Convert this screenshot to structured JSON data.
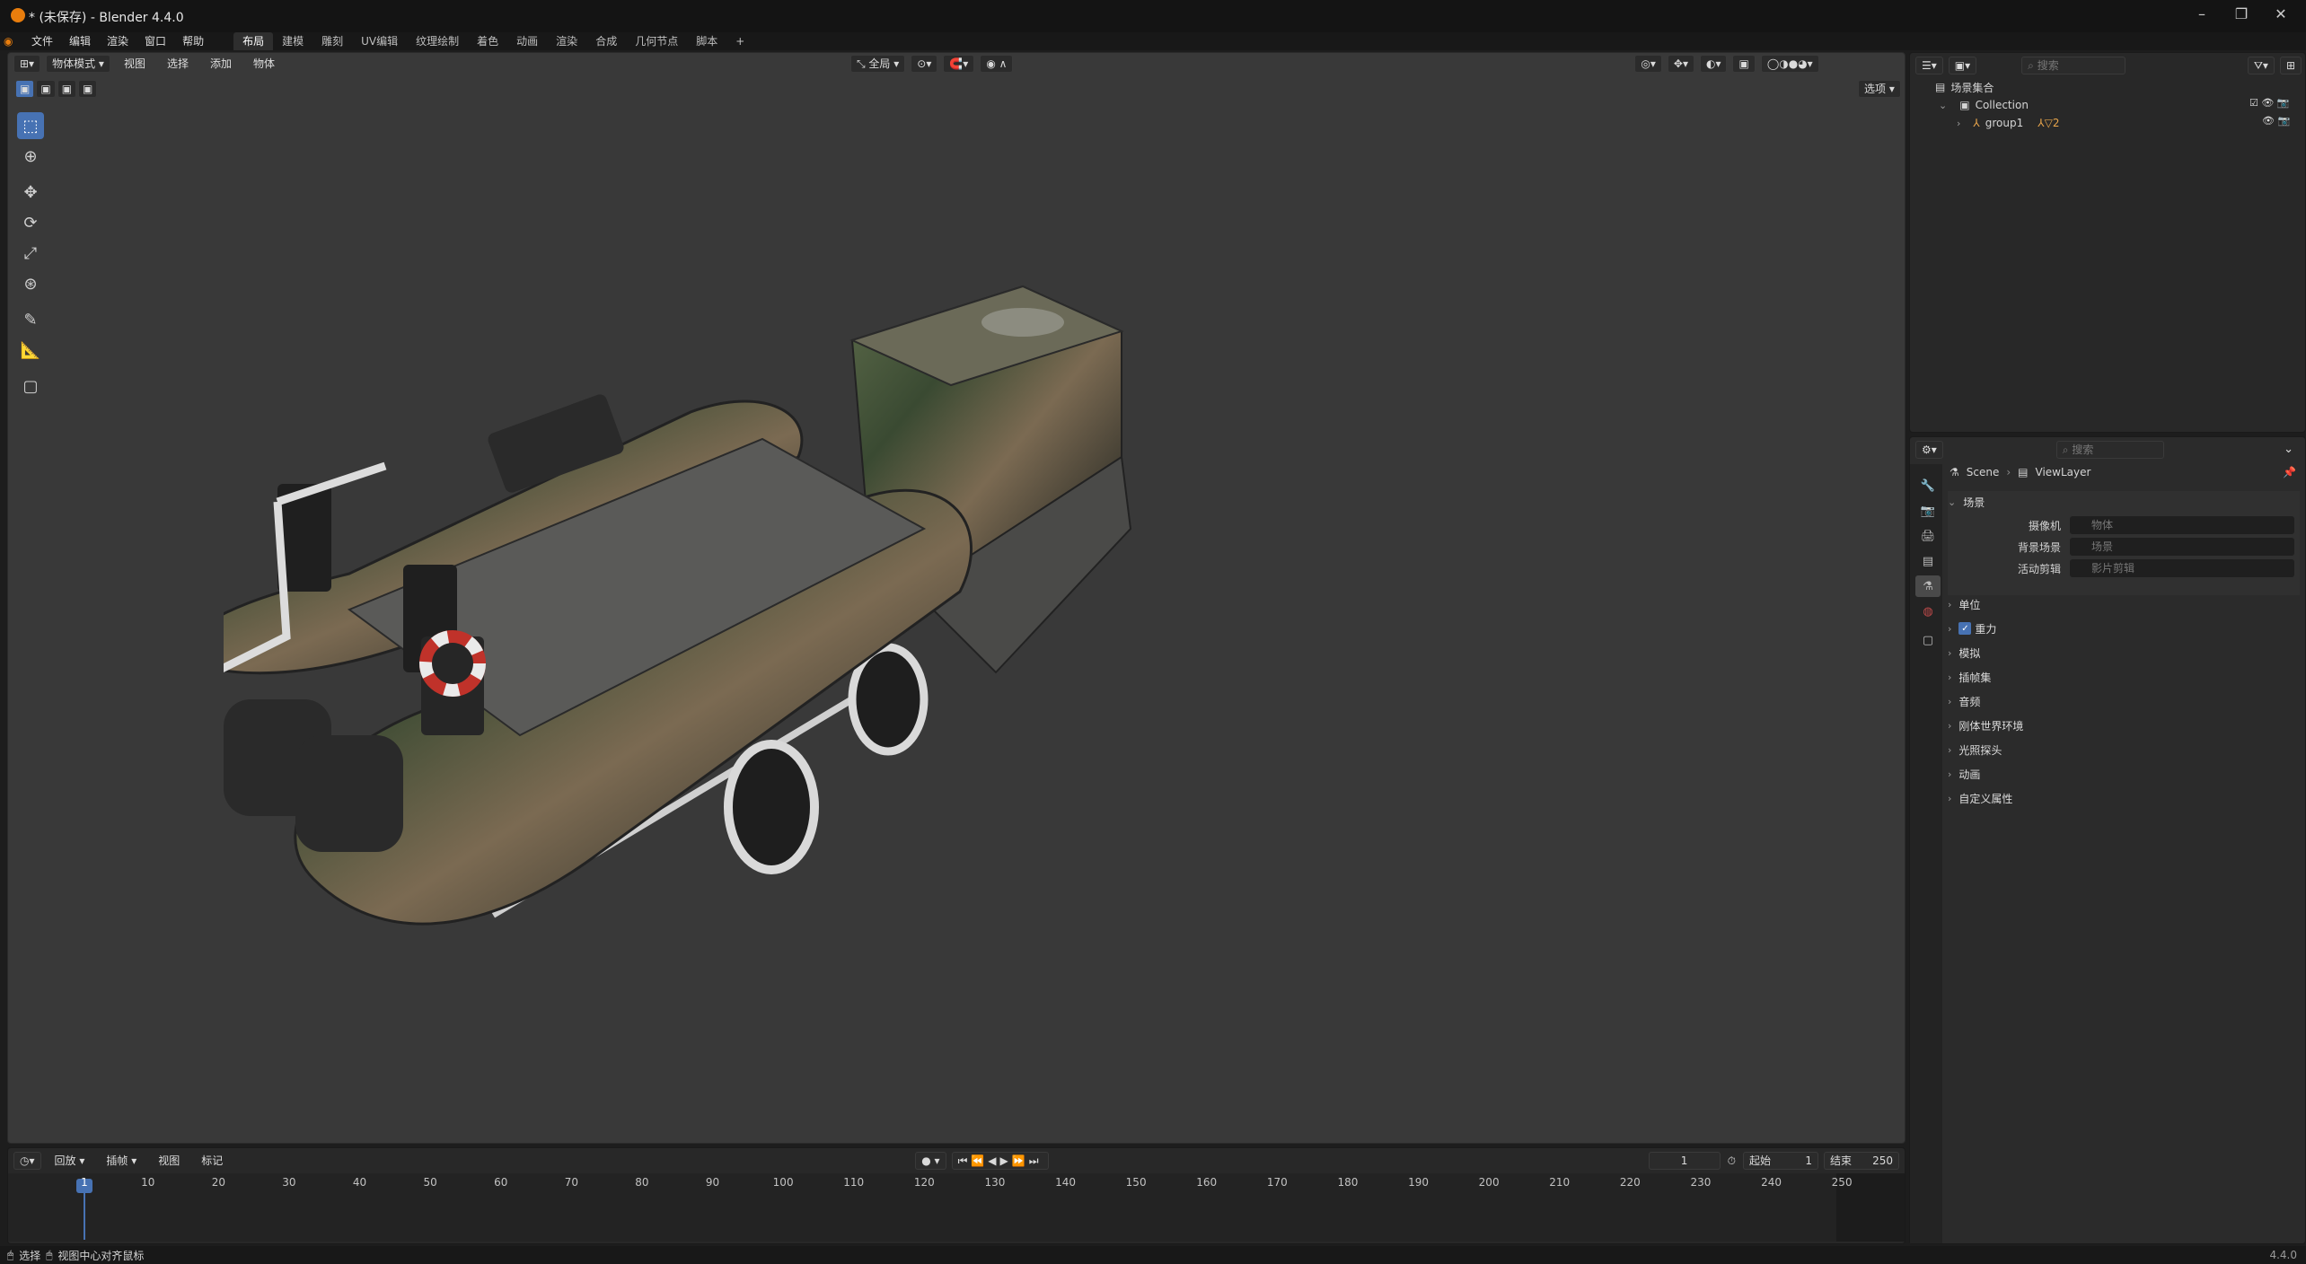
{
  "window": {
    "title": "* (未保存) - Blender 4.4.0",
    "min": "–",
    "max": "❐",
    "close": "✕"
  },
  "menu": [
    "文件",
    "编辑",
    "渲染",
    "窗口",
    "帮助"
  ],
  "workspaces": [
    "布局",
    "建模",
    "雕刻",
    "UV编辑",
    "纹理绘制",
    "着色",
    "动画",
    "渲染",
    "合成",
    "几何节点",
    "脚本"
  ],
  "workspace_add": "+",
  "viewport_header": {
    "mode": "物体模式",
    "items": [
      "视图",
      "选择",
      "添加",
      "物体"
    ],
    "transform": "全局",
    "options": "选项"
  },
  "outliner": {
    "search_placeholder": "搜索",
    "scene": "Scene",
    "view_layer": "ViewLayer",
    "root": "场景集合",
    "collection": "Collection",
    "object": "group1",
    "object_badge": "2"
  },
  "properties": {
    "search_placeholder": "搜索",
    "breadcrumb": [
      "Scene",
      "ViewLayer"
    ],
    "panel": "场景",
    "camera_label": "摄像机",
    "camera_placeholder": "物体",
    "bg_label": "背景场景",
    "bg_placeholder": "场景",
    "clip_label": "活动剪辑",
    "clip_placeholder": "影片剪辑",
    "sections": [
      "单位",
      "重力",
      "模拟",
      "插帧集",
      "音频",
      "刚体世界环境",
      "光照探头",
      "动画",
      "自定义属性"
    ],
    "gravity_checked": true
  },
  "timeline": {
    "menus": [
      "回放",
      "插帧",
      "视图",
      "标记"
    ],
    "current_frame": "1",
    "start_label": "起始",
    "start": "1",
    "end_label": "结束",
    "end": "250",
    "ticks": [
      "1",
      "10",
      "20",
      "30",
      "40",
      "50",
      "60",
      "70",
      "80",
      "90",
      "100",
      "110",
      "120",
      "130",
      "140",
      "150",
      "160",
      "170",
      "180",
      "190",
      "200",
      "210",
      "220",
      "230",
      "240",
      "250"
    ]
  },
  "status": {
    "left1": "选择",
    "left2": "视图中心对齐鼠标",
    "version": "4.4.0"
  },
  "colors": {
    "accent": "#4772b3",
    "orange": "#e87d0d"
  }
}
